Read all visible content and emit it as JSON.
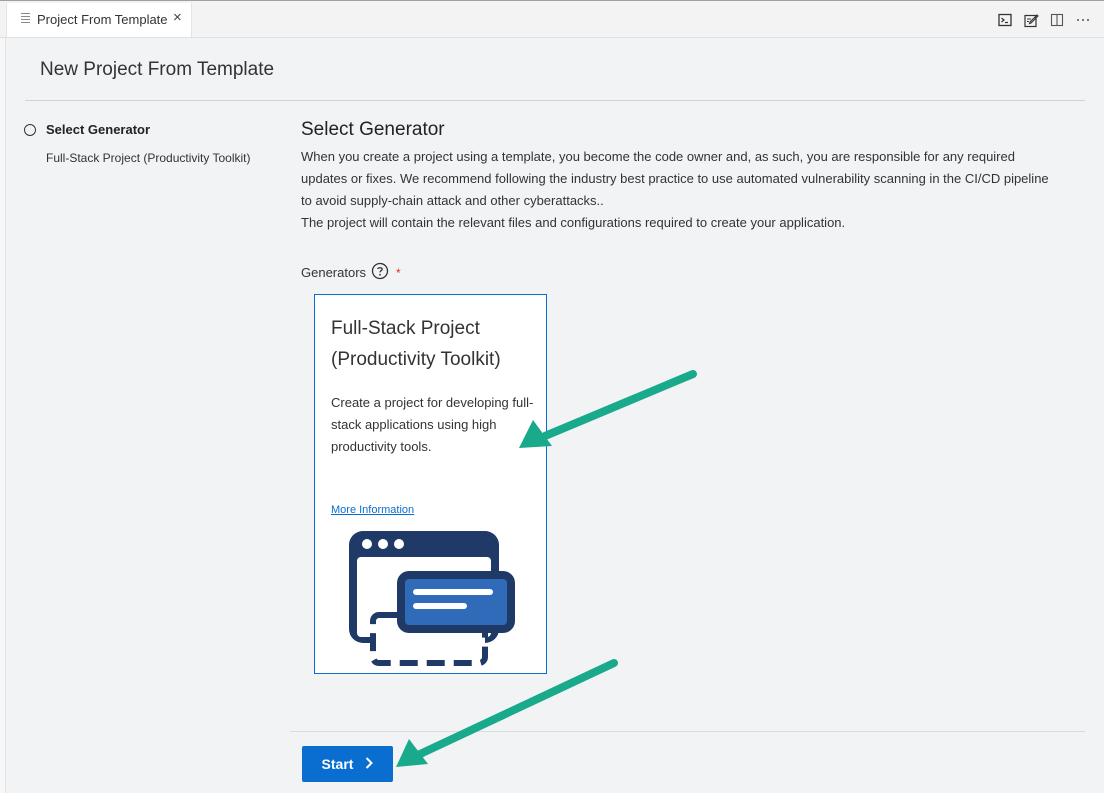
{
  "tab": {
    "label": "Project From Template",
    "close": "×"
  },
  "header": {
    "title": "New Project From Template"
  },
  "stepper": {
    "step_title": "Select Generator",
    "step_selection": "Full-Stack Project (Productivity Toolkit)"
  },
  "main": {
    "title": "Select Generator",
    "description": [
      "When you create a project using a template, you become the code owner and, as such, you are responsible for any required updates or fixes. We recommend following the industry best practice to use automated vulnerability scanning in the CI/CD pipeline to avoid supply-chain attack and other cyberattacks..",
      "The project will contain the relevant files and configurations required to create your application."
    ],
    "generators_label": "Generators",
    "required_mark": "*"
  },
  "card": {
    "title": "Full-Stack Project (Productivity Toolkit)",
    "description": "Create a project for developing full-stack applications using high productivity tools.",
    "link": "More Information"
  },
  "footer": {
    "start_label": "Start",
    "start_chevron": "›"
  },
  "colors": {
    "accent": "#0a6ed1",
    "arrow": "#19a98b",
    "illustration_dark": "#1f3a66"
  },
  "icons": [
    "tab-file-icon",
    "terminal-icon",
    "edit-icon",
    "split-editor-icon",
    "more-icon",
    "help-circle-icon",
    "chevron-right-icon"
  ]
}
